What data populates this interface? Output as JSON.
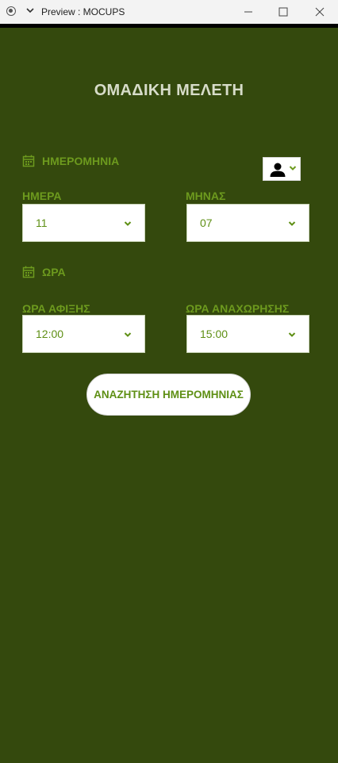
{
  "window": {
    "title": "Preview : MOCUPS"
  },
  "page": {
    "title": "ΟΜΑΔΙΚΗ ΜΕΛΕΤΗ"
  },
  "date_section": {
    "heading": "ΗΜΕΡΟΜΗΝΙΑ",
    "day": {
      "label": "ΗΜΕΡΑ",
      "value": "11"
    },
    "month": {
      "label": "ΜΗΝΑΣ",
      "value": "07"
    }
  },
  "time_section": {
    "heading": "ΩΡΑ",
    "arrival": {
      "label": "ΩΡΑ ΑΦΙΞΗΣ",
      "value": "12:00"
    },
    "departure": {
      "label": "ΩΡΑ ΑΝΑΧΩΡΗΣΗΣ",
      "value": "15:00"
    }
  },
  "actions": {
    "search_label": "ΑΝΑΖΗΤΗΣΗ ΗΜΕΡΟΜΗΝΙΑΣ"
  },
  "colors": {
    "background": "#34490d",
    "accent": "#6d9a1e",
    "title_text": "#d7dcc9",
    "control_bg": "#ffffff"
  },
  "icons": {
    "app": "record-icon",
    "menu": "chevron-down-icon",
    "minimize": "minimize-icon",
    "maximize": "maximize-icon",
    "close": "close-icon",
    "calendar": "calendar-icon",
    "user": "user-icon",
    "dropdown": "chevron-down-icon"
  }
}
